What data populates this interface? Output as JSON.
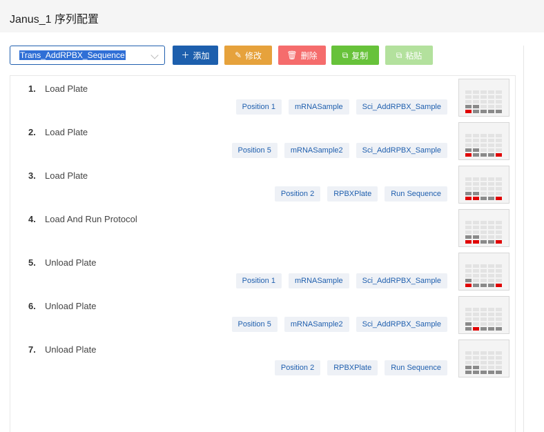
{
  "header": {
    "title": "Janus_1 序列配置"
  },
  "toolbar": {
    "sequence_value": "Trans_AddRPBX_Sequence",
    "add_label": "添加",
    "edit_label": "修改",
    "delete_label": "删除",
    "copy_label": "复制",
    "paste_label": "粘贴",
    "colors": {
      "add": "#1d5fad",
      "edit": "#e6a23c",
      "delete": "#f56c6c",
      "copy": "#67c23a",
      "paste_disabled": "#b3e19d"
    }
  },
  "steps": [
    {
      "num": "1.",
      "name": "Load Plate",
      "tags": [
        "Position 1",
        "mRNASample",
        "Sci_AddRPBX_Sample"
      ]
    },
    {
      "num": "2.",
      "name": "Load Plate",
      "tags": [
        "Position 5",
        "mRNASample2",
        "Sci_AddRPBX_Sample"
      ]
    },
    {
      "num": "3.",
      "name": "Load Plate",
      "tags": [
        "Position 2",
        "RPBXPlate",
        "Run Sequence"
      ]
    },
    {
      "num": "4.",
      "name": "Load And Run Protocol",
      "tags": []
    },
    {
      "num": "5.",
      "name": "Unload Plate",
      "tags": [
        "Position 1",
        "mRNASample",
        "Sci_AddRPBX_Sample"
      ]
    },
    {
      "num": "6.",
      "name": "Unload Plate",
      "tags": [
        "Position 5",
        "mRNASample2",
        "Sci_AddRPBX_Sample"
      ]
    },
    {
      "num": "7.",
      "name": "Unload Plate",
      "tags": [
        "Position 2",
        "RPBXPlate",
        "Run Sequence"
      ]
    }
  ]
}
